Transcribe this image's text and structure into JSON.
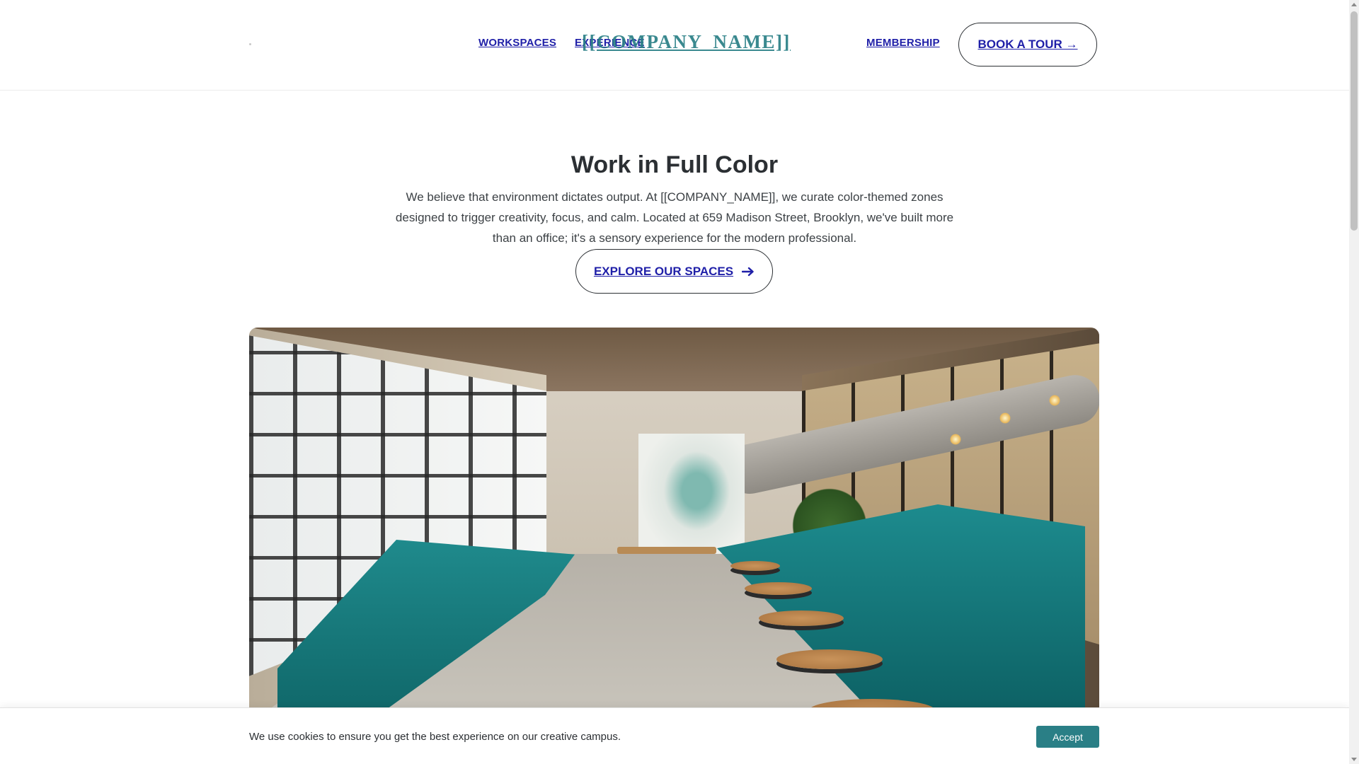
{
  "header": {
    "nav": {
      "workspaces": "WORKSPACES",
      "experience": "EXPERIENCE",
      "membership": "MEMBERSHIP"
    },
    "brand": "[[COMPANY_NAME]]",
    "cta": "BOOK A TOUR →"
  },
  "hero": {
    "title": "Work in Full Color",
    "text": "We believe that environment dictates output. At [[COMPANY_NAME]], we curate color-themed zones designed to trigger creativity, focus, and calm. Located at 659 Madison Street, Brooklyn, we've built more than an office; it's a sensory experience for the modern professional.",
    "button": "EXPLORE OUR SPACES",
    "button_icon": "arrow-right-icon"
  },
  "cookie": {
    "text": "We use cookies to ensure you get the best experience on our creative campus.",
    "accept": "Accept"
  },
  "colors": {
    "accent": "#2a7f86",
    "link": "#1f1fa8",
    "text": "#2b2f33"
  }
}
